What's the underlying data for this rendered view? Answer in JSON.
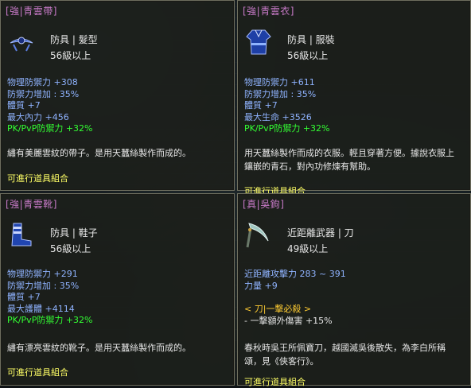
{
  "tooltips": [
    {
      "title": "[強|青雲帶]",
      "icon": "belt-icon",
      "type": "防具 | 髮型",
      "level": "56級以上",
      "stats": [
        {
          "text": "物理防禦力 +308",
          "color": "blue"
        },
        {
          "text": "防禦力增加 : 35%",
          "color": "blue"
        },
        {
          "text": "體質 +7",
          "color": "blue"
        },
        {
          "text": "最大內力 +456",
          "color": "blue"
        },
        {
          "text": "PK/PvP防禦力 +32%",
          "color": "green"
        }
      ],
      "description": "繡有美麗雲紋的帶子。是用天蠶絲製作而成的。",
      "combine": "可進行道具組合"
    },
    {
      "title": "[強|青雲衣]",
      "icon": "robe-icon",
      "type": "防具 | 服裝",
      "level": "56級以上",
      "stats": [
        {
          "text": "物理防禦力 +611",
          "color": "blue"
        },
        {
          "text": "防禦力增加 : 35%",
          "color": "blue"
        },
        {
          "text": "體質 +7",
          "color": "blue"
        },
        {
          "text": "最大生命 +3526",
          "color": "blue"
        },
        {
          "text": "PK/PvP防禦力 +32%",
          "color": "green"
        }
      ],
      "description": "用天蠶絲製作而成的衣服。輕且穿著方便。據說衣服上鑲嵌的青石，對內功修煉有幫助。",
      "combine": "可進行道具組合"
    },
    {
      "title": "[強|青雲靴]",
      "icon": "boots-icon",
      "type": "防具 | 鞋子",
      "level": "56級以上",
      "stats": [
        {
          "text": "物理防禦力 +291",
          "color": "blue"
        },
        {
          "text": "防禦力增加 : 35%",
          "color": "blue"
        },
        {
          "text": "體質 +7",
          "color": "blue"
        },
        {
          "text": "最大護體 +4114",
          "color": "blue"
        },
        {
          "text": "PK/PvP防禦力 +32%",
          "color": "green"
        }
      ],
      "description": "繡有漂亮雲紋的靴子。是用天蠶絲製作而成的。",
      "combine": "可進行道具組合"
    },
    {
      "title": "[真|吳鉤]",
      "icon": "curved-blade-icon",
      "type": "近距離武器 | 刀",
      "level": "49級以上",
      "stats": [
        {
          "text": "近距離攻擊力 283 ~ 391",
          "color": "blue"
        },
        {
          "text": "力量 +9",
          "color": "blue"
        }
      ],
      "special_header": "< 刀|一擊必殺 >",
      "special_line": "- 一擊額外傷害 +15%",
      "description": "春秋時吳王所佩寶刀，越國滅吳後散失，為李白所稱頌，見《俠客行》。",
      "combine": "可進行道具組合"
    }
  ]
}
